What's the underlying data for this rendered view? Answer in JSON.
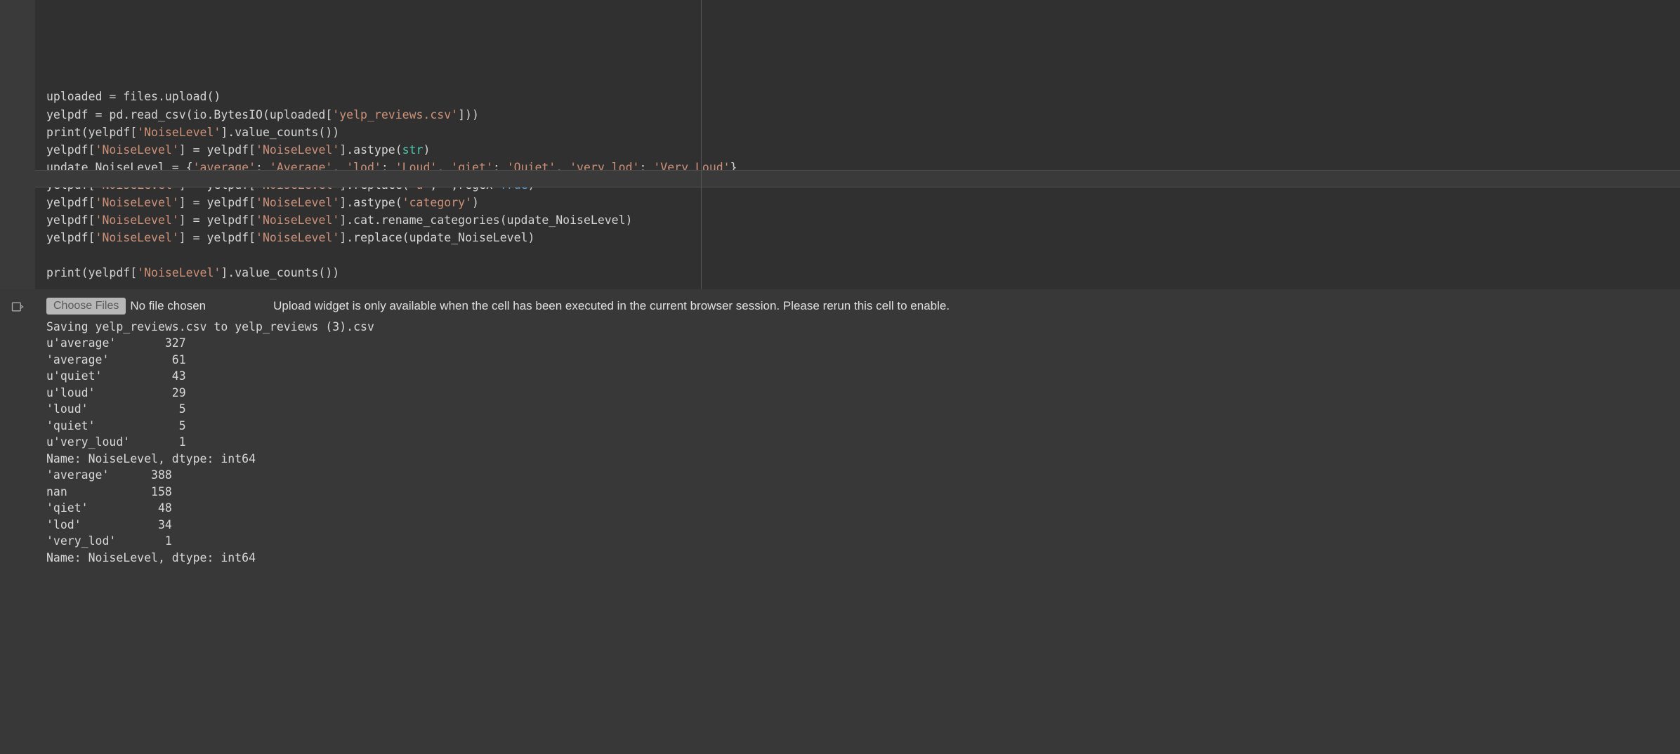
{
  "code": {
    "lines": [
      [
        {
          "c": "tk-id",
          "t": "uploaded = files.upload()"
        }
      ],
      [
        {
          "c": "tk-id",
          "t": "yelpdf = pd.read_csv(io.BytesIO(uploaded["
        },
        {
          "c": "tk-str",
          "t": "'yelp_reviews.csv'"
        },
        {
          "c": "tk-id",
          "t": "]))"
        }
      ],
      [
        {
          "c": "tk-id",
          "t": "print(yelpdf["
        },
        {
          "c": "tk-str",
          "t": "'NoiseLevel'"
        },
        {
          "c": "tk-id",
          "t": "].value_counts())"
        }
      ],
      [
        {
          "c": "tk-id",
          "t": "yelpdf["
        },
        {
          "c": "tk-str",
          "t": "'NoiseLevel'"
        },
        {
          "c": "tk-id",
          "t": "] = yelpdf["
        },
        {
          "c": "tk-str",
          "t": "'NoiseLevel'"
        },
        {
          "c": "tk-id",
          "t": "].astype("
        },
        {
          "c": "tk-builtin",
          "t": "str"
        },
        {
          "c": "tk-id",
          "t": ")"
        }
      ],
      [
        {
          "c": "tk-id",
          "t": "update_NoiseLevel = {"
        },
        {
          "c": "tk-str",
          "t": "'average'"
        },
        {
          "c": "tk-id",
          "t": ": "
        },
        {
          "c": "tk-str",
          "t": "'Average'"
        },
        {
          "c": "tk-id",
          "t": ", "
        },
        {
          "c": "tk-str",
          "t": "'lod'"
        },
        {
          "c": "tk-id",
          "t": ": "
        },
        {
          "c": "tk-str",
          "t": "'Loud'"
        },
        {
          "c": "tk-id",
          "t": ", "
        },
        {
          "c": "tk-str",
          "t": "'qiet'"
        },
        {
          "c": "tk-id",
          "t": ": "
        },
        {
          "c": "tk-str",
          "t": "'Quiet'"
        },
        {
          "c": "tk-id",
          "t": ", "
        },
        {
          "c": "tk-str",
          "t": "'very_lod'"
        },
        {
          "c": "tk-id",
          "t": ": "
        },
        {
          "c": "tk-str",
          "t": "'Very Loud'"
        },
        {
          "c": "tk-id",
          "t": "}"
        }
      ],
      [
        {
          "c": "tk-id",
          "t": "yelpdf["
        },
        {
          "c": "tk-str",
          "t": "'NoiseLevel'"
        },
        {
          "c": "tk-id",
          "t": "] = yelpdf["
        },
        {
          "c": "tk-str",
          "t": "'NoiseLevel'"
        },
        {
          "c": "tk-id",
          "t": "].replace("
        },
        {
          "c": "tk-str",
          "t": "'u'"
        },
        {
          "c": "tk-id",
          "t": ","
        },
        {
          "c": "tk-str",
          "t": "''"
        },
        {
          "c": "tk-id",
          "t": ",regex="
        },
        {
          "c": "tk-kw",
          "t": "True"
        },
        {
          "c": "tk-id",
          "t": ")"
        }
      ],
      [
        {
          "c": "tk-id",
          "t": "yelpdf["
        },
        {
          "c": "tk-str",
          "t": "'NoiseLevel'"
        },
        {
          "c": "tk-id",
          "t": "] = yelpdf["
        },
        {
          "c": "tk-str",
          "t": "'NoiseLevel'"
        },
        {
          "c": "tk-id",
          "t": "].astype("
        },
        {
          "c": "tk-str",
          "t": "'category'"
        },
        {
          "c": "tk-id",
          "t": ")"
        }
      ],
      [
        {
          "c": "tk-id",
          "t": "yelpdf["
        },
        {
          "c": "tk-str",
          "t": "'NoiseLevel'"
        },
        {
          "c": "tk-id",
          "t": "] = yelpdf["
        },
        {
          "c": "tk-str",
          "t": "'NoiseLevel'"
        },
        {
          "c": "tk-id",
          "t": "].cat.rename_categories(update_NoiseLevel)"
        }
      ],
      [
        {
          "c": "tk-id",
          "t": "yelpdf["
        },
        {
          "c": "tk-str",
          "t": "'NoiseLevel'"
        },
        {
          "c": "tk-id",
          "t": "] = yelpdf["
        },
        {
          "c": "tk-str",
          "t": "'NoiseLevel'"
        },
        {
          "c": "tk-id",
          "t": "].replace(update_NoiseLevel)"
        }
      ],
      [
        {
          "c": "tk-id",
          "t": ""
        }
      ],
      [
        {
          "c": "tk-id",
          "t": "print(yelpdf["
        },
        {
          "c": "tk-str",
          "t": "'NoiseLevel'"
        },
        {
          "c": "tk-id",
          "t": "].value_counts())"
        }
      ]
    ]
  },
  "output": {
    "choose_files_label": "Choose Files",
    "no_file_label": "No file chosen",
    "upload_message": "Upload widget is only available when the cell has been executed in the current browser session. Please rerun this cell to enable.",
    "text": "Saving yelp_reviews.csv to yelp_reviews (3).csv\nu'average'       327\n'average'         61\nu'quiet'          43\nu'loud'           29\n'loud'             5\n'quiet'            5\nu'very_loud'       1\nName: NoiseLevel, dtype: int64\n'average'      388\nnan            158\n'qiet'          48\n'lod'           34\n'very_lod'       1\nName: NoiseLevel, dtype: int64"
  }
}
